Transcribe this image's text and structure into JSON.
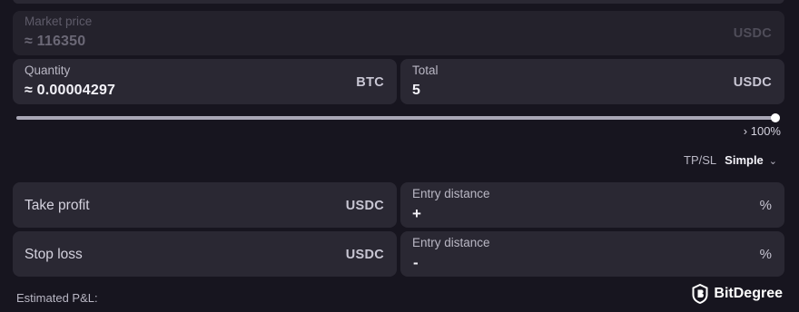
{
  "market_price": {
    "label": "Market price",
    "value": "≈ 116350",
    "unit": "USDC"
  },
  "quantity": {
    "label": "Quantity",
    "value": "≈ 0.00004297",
    "unit": "BTC"
  },
  "total": {
    "label": "Total",
    "value": "5",
    "unit": "USDC"
  },
  "slider": {
    "percent": 100,
    "readout": "› 100%"
  },
  "tpsl": {
    "label": "TP/SL",
    "mode": "Simple"
  },
  "take_profit": {
    "label": "Take profit",
    "unit": "USDC",
    "distance_label": "Entry distance",
    "sign": "+",
    "pct": "%"
  },
  "stop_loss": {
    "label": "Stop loss",
    "unit": "USDC",
    "distance_label": "Entry distance",
    "sign": "-",
    "pct": "%"
  },
  "estimated_pnl": {
    "label": "Estimated P&L:"
  },
  "watermark": {
    "text": "BitDegree"
  },
  "colors": {
    "background": "#17151f",
    "field": "#2a2833",
    "text": "#f3f2f8"
  }
}
